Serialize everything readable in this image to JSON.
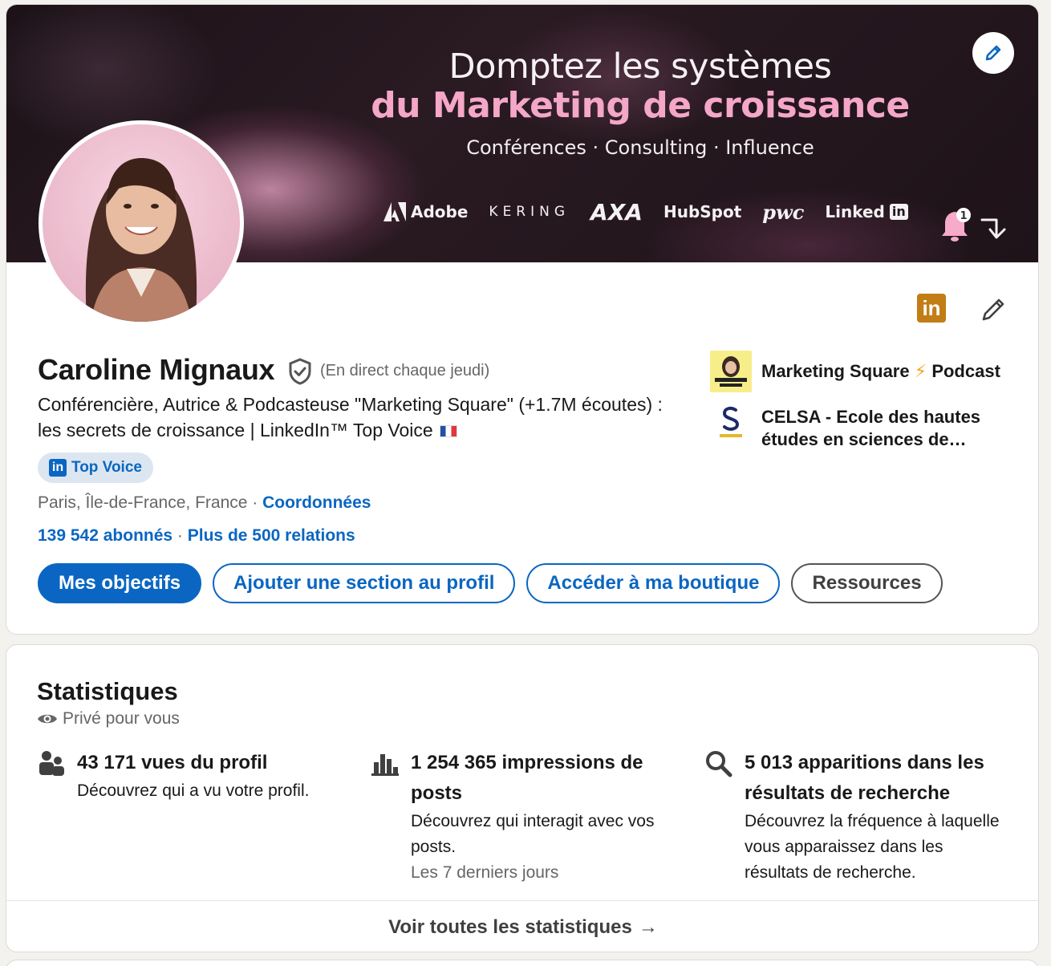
{
  "banner": {
    "title": "Domptez les systèmes",
    "subtitle": "du Marketing de croissance",
    "tagline": "Conférences · Consulting · Influence",
    "brands": [
      "Adobe",
      "KERING",
      "AXA",
      "HubSpot",
      "pwc",
      "Linked"
    ],
    "brand_in": "in",
    "bell_count": "1"
  },
  "profile": {
    "name": "Caroline Mignaux",
    "live_note": "(En direct chaque jeudi)",
    "headline": "Conférencière, Autrice & Podcasteuse \"Marketing Square\" (+1.7M écoutes) : les secrets de croissance | LinkedIn™ Top Voice",
    "badge": "Top Voice",
    "badge_in": "in",
    "location": "Paris, Île-de-France, France",
    "location_sep": " · ",
    "contact_link": "Coordonnées",
    "followers": "139 542 abonnés",
    "network_sep": " · ",
    "connections": "Plus de 500 relations",
    "in_logo": "in"
  },
  "actions": {
    "goals": "Mes objectifs",
    "add_section": "Ajouter une section au profil",
    "shop": "Accéder à ma boutique",
    "resources": "Ressources"
  },
  "orgs": [
    {
      "name": "Marketing Square",
      "bolt": "⚡",
      "suffix": "Podcast"
    },
    {
      "name": "CELSA - Ecole des hautes études en sciences de…"
    }
  ],
  "stats": {
    "title": "Statistiques",
    "privacy": "Privé pour vous",
    "items": [
      {
        "title": "43 171 vues du profil",
        "desc": "Découvrez qui a vu votre profil.",
        "icon": "people-icon"
      },
      {
        "title": "1 254 365 impressions de posts",
        "desc": "Découvrez qui interagit avec vos posts.",
        "note": "Les 7 derniers jours",
        "icon": "bar-chart-icon"
      },
      {
        "title": "5 013 apparitions dans les résultats de recherche",
        "desc": "Découvrez la fréquence à laquelle vous apparaissez dans les résultats de recherche.",
        "icon": "search-icon"
      }
    ],
    "footer": "Voir toutes les statistiques",
    "footer_arrow": "→"
  },
  "colors": {
    "accent": "#0a66c2",
    "badge_bg": "#dce6f1",
    "banner_pink": "#f4a7c8",
    "in_logo": "#c37d16"
  }
}
